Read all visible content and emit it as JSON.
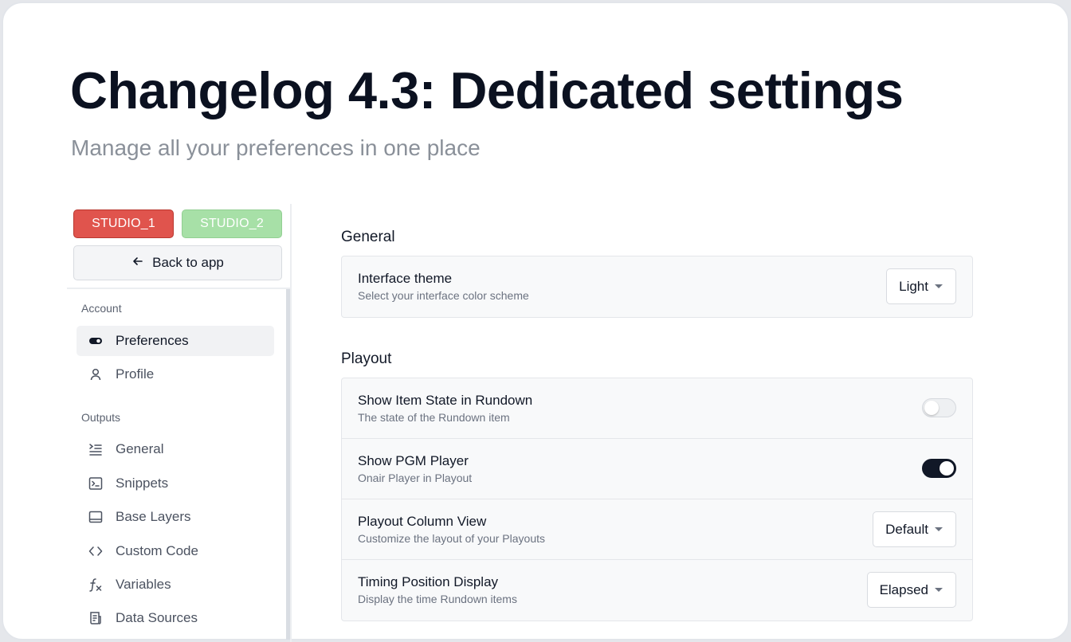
{
  "header": {
    "title": "Changelog 4.3: Dedicated settings",
    "subtitle": "Manage all your preferences in one place"
  },
  "colors": {
    "studio_1": "#e0544d",
    "studio_2": "#a7e0a7",
    "toggle_on": "#111827"
  },
  "sidebar": {
    "studios": [
      "STUDIO_1",
      "STUDIO_2"
    ],
    "back_label": "Back to app",
    "account_label": "Account",
    "account_items": [
      {
        "label": "Preferences",
        "icon": "toggle-icon",
        "active": true
      },
      {
        "label": "Profile",
        "icon": "user-icon",
        "active": false
      }
    ],
    "outputs_label": "Outputs",
    "outputs_items": [
      {
        "label": "General",
        "icon": "list-indent-icon"
      },
      {
        "label": "Snippets",
        "icon": "terminal-icon"
      },
      {
        "label": "Base Layers",
        "icon": "layer-panel-icon"
      },
      {
        "label": "Custom Code",
        "icon": "code-icon"
      },
      {
        "label": "Variables",
        "icon": "function-icon"
      },
      {
        "label": "Data Sources",
        "icon": "document-icon"
      }
    ]
  },
  "main": {
    "general": {
      "title": "General",
      "rows": [
        {
          "title": "Interface theme",
          "desc": "Select your interface color scheme",
          "value": "Light"
        }
      ]
    },
    "playout": {
      "title": "Playout",
      "rows": [
        {
          "title": "Show Item State in Rundown",
          "desc": "The state of the Rundown item",
          "toggle": false
        },
        {
          "title": "Show PGM Player",
          "desc": "Onair Player in Playout",
          "toggle": true
        },
        {
          "title": "Playout Column View",
          "desc": "Customize the layout of your Playouts",
          "value": "Default"
        },
        {
          "title": "Timing Position Display",
          "desc": "Display the time Rundown items",
          "value": "Elapsed"
        }
      ]
    }
  }
}
